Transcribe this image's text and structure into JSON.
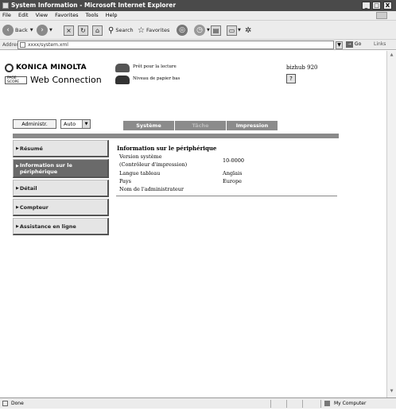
{
  "window": {
    "title": "System Information - Microsoft Internet Explorer",
    "min": "_",
    "max": "□",
    "close": "X"
  },
  "menu": [
    "File",
    "Edit",
    "View",
    "Favorites",
    "Tools",
    "Help"
  ],
  "toolbar": {
    "back": "Back",
    "search": "Search",
    "favorites": "Favorites"
  },
  "address": {
    "label": "Address",
    "value": "xxxx/system.xml",
    "go": "Go",
    "links": "Links"
  },
  "page": {
    "brand": "KONICA MINOLTA",
    "pagescope": "PAGE SCOPE",
    "web_connection": "Web Connection",
    "status_ready": "Prêt pour la lecture",
    "status_paper": "Niveau de papier bas",
    "model": "bizhub 920",
    "help": "?"
  },
  "controls": {
    "admin_button": "Administr.",
    "mode_select": "Auto",
    "dropdown_arrow": "▼"
  },
  "tabs": {
    "systeme": "Système",
    "tache": "Tâche",
    "impression": "Impression"
  },
  "sidebar": {
    "items": [
      {
        "label": "Résumé"
      },
      {
        "label": "Information sur le périphérique"
      },
      {
        "label": "Détail"
      },
      {
        "label": "Compteur"
      },
      {
        "label": "Assistance en ligne"
      }
    ]
  },
  "content": {
    "title": "Information sur le périphérique",
    "rows": [
      {
        "label": "Version système",
        "value": "10-0000"
      },
      {
        "label": "(Contrôleur d'impression)",
        "value": ""
      },
      {
        "label": "Langue tableau",
        "value": "Anglais"
      },
      {
        "label": "Pays",
        "value": "Europe"
      },
      {
        "label": "Nom de l'administrateur",
        "value": ""
      }
    ]
  },
  "statusbar": {
    "left": "Done",
    "right": "My Computer"
  }
}
